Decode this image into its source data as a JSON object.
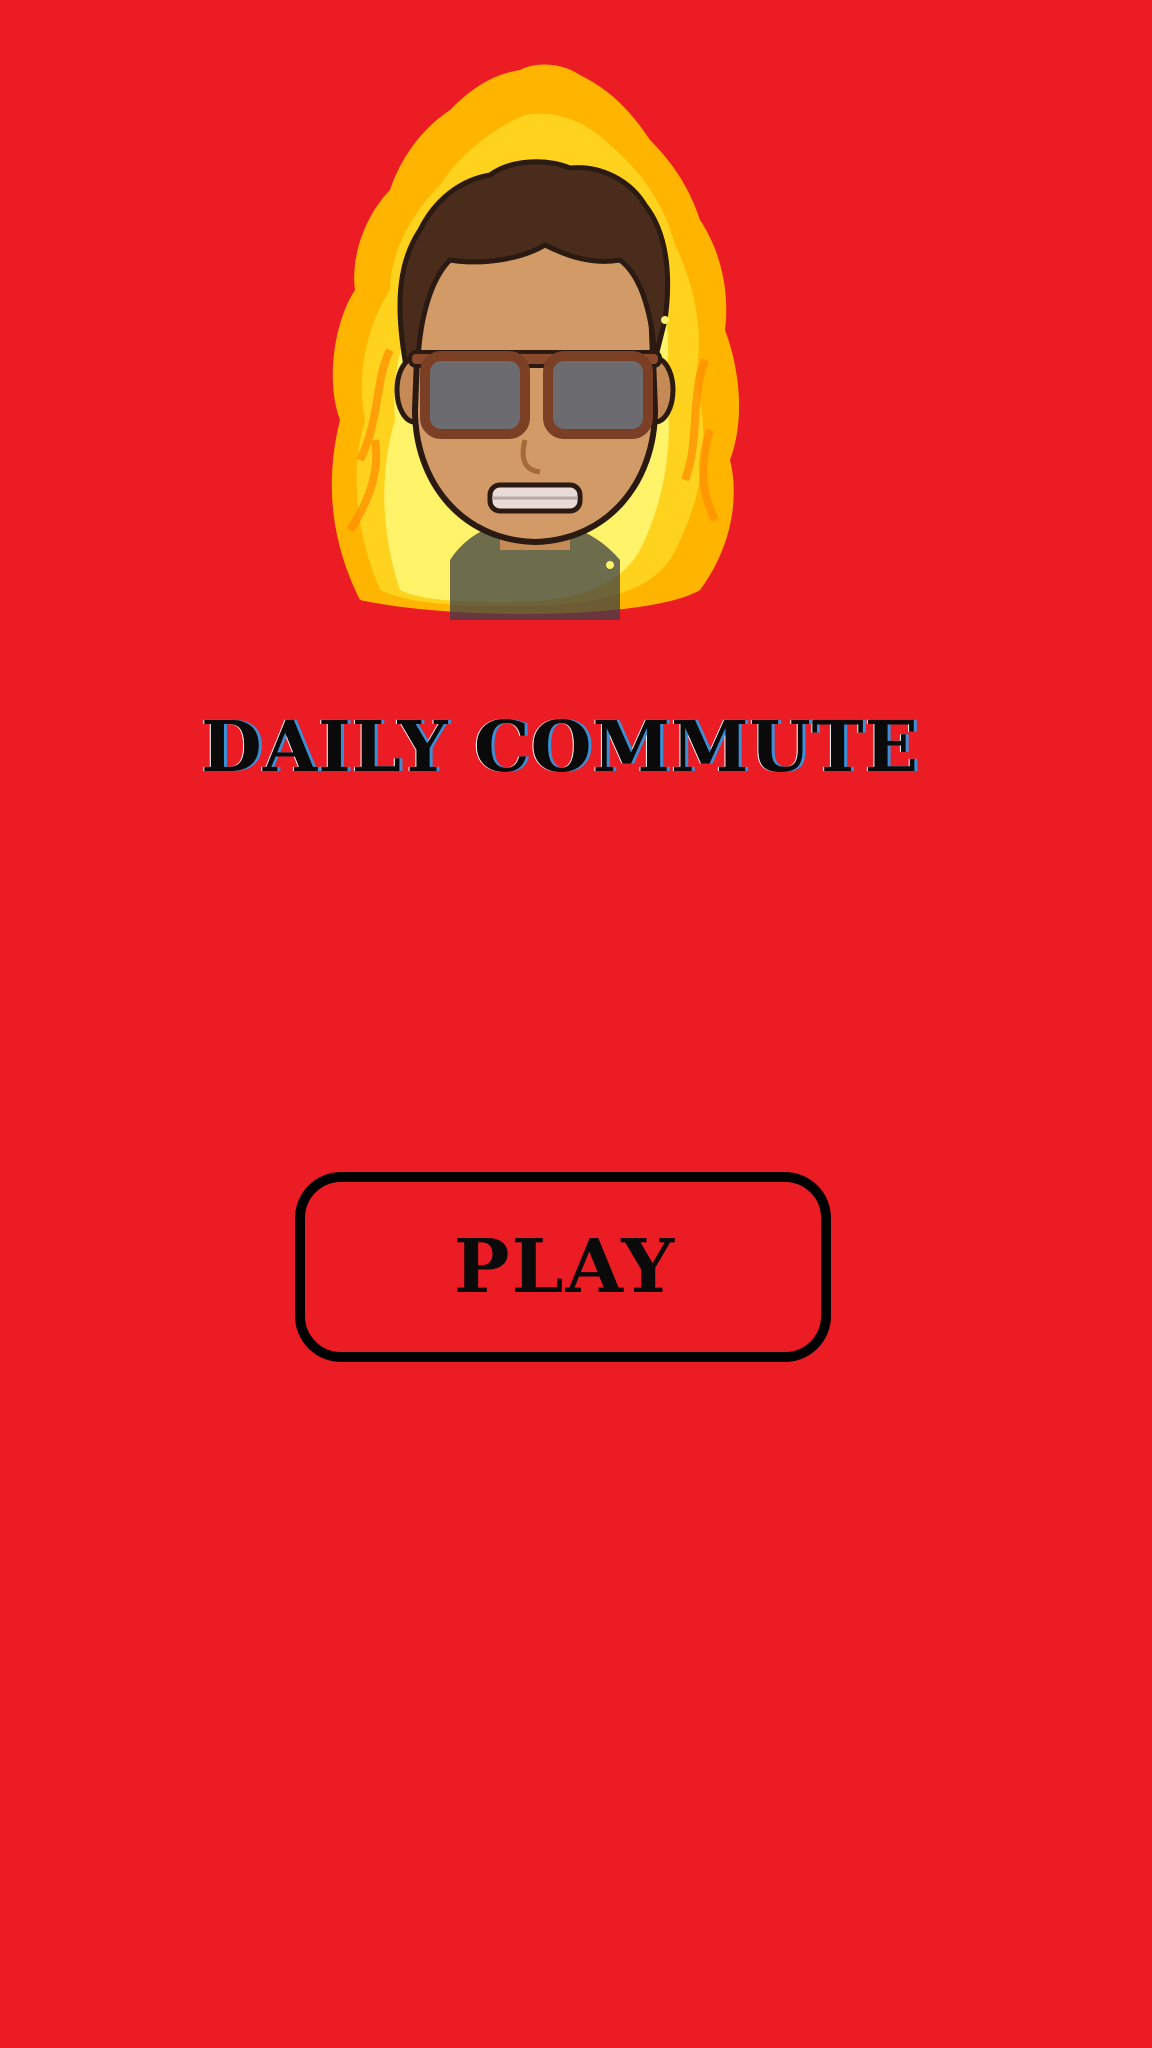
{
  "game": {
    "title": "DAILY COMMUTE",
    "play_label": "PLAY"
  },
  "colors": {
    "background": "#ec1c24",
    "text": "#0a0a0a",
    "button_border": "#000000",
    "flame_outer": "#ffb400",
    "flame_inner": "#fff36a",
    "skin": "#d19a66",
    "hair": "#4a2c1c",
    "glasses_frame": "#8a4a2c",
    "lenses": "#6b6b70"
  },
  "icons": {
    "mascot": "flaming-face-with-sunglasses"
  }
}
